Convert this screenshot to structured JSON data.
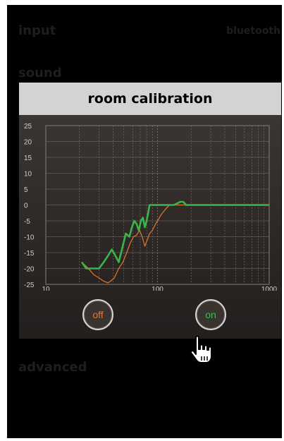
{
  "background": {
    "input_label": "input",
    "input_value": "bluetooth",
    "sound_label": "sound",
    "advanced_label": "advanced"
  },
  "dialog": {
    "title": "room calibration",
    "off_label": "off",
    "on_label": "on"
  },
  "colors": {
    "on_green": "#3dbb4e",
    "off_orange": "#e0782f"
  },
  "icons": {
    "pointer": "hand-pointer-icon"
  },
  "chart_data": {
    "type": "line",
    "x_scale": "log",
    "xlim": [
      10,
      1000
    ],
    "ylim": [
      -25,
      25
    ],
    "x_ticks": [
      "10",
      "100",
      "1000"
    ],
    "y_ticks": [
      "25",
      "20",
      "15",
      "10",
      "5",
      "0",
      "-5",
      "-10",
      "-15",
      "-20",
      "-25"
    ],
    "grid": true,
    "series": [
      {
        "color": "#d9742c",
        "x": [
          21,
          24,
          27,
          30,
          33,
          36,
          38,
          41,
          45,
          49,
          53,
          57,
          61,
          65,
          69,
          73,
          77,
          81,
          85,
          90,
          96,
          102,
          108,
          114,
          120,
          128,
          136,
          145,
          155,
          165,
          175,
          185,
          200,
          230,
          270,
          330,
          400,
          500,
          600,
          700,
          800,
          1000
        ],
        "y": [
          -18,
          -20,
          -22,
          -23,
          -24,
          -24.5,
          -24,
          -23,
          -20,
          -18,
          -15,
          -12,
          -10,
          -9.5,
          -8,
          -10,
          -13,
          -11,
          -9,
          -8,
          -6,
          -4.5,
          -3,
          -2,
          -1,
          0,
          0,
          0,
          0,
          0,
          0,
          0,
          0,
          0,
          0,
          0,
          0,
          0,
          0,
          0,
          0,
          0
        ]
      },
      {
        "color": "#39b54a",
        "x": [
          21,
          23,
          26,
          30,
          33,
          36,
          39,
          42,
          45,
          48,
          52,
          56,
          59,
          62,
          65,
          68,
          71,
          74,
          77,
          80,
          85,
          90,
          100,
          120,
          140,
          150,
          160,
          170,
          180,
          200,
          250,
          300,
          400,
          500,
          600,
          700,
          800,
          1000
        ],
        "y": [
          -18,
          -20,
          -20,
          -20,
          -18,
          -16,
          -14,
          -16,
          -18,
          -14,
          -9,
          -10,
          -7,
          -5,
          -6,
          -8,
          -5,
          -4,
          -7,
          -5,
          0,
          0,
          0,
          0,
          0,
          0.5,
          1,
          1,
          0,
          0,
          0,
          0,
          0,
          0,
          0,
          0,
          0,
          0
        ]
      }
    ]
  }
}
